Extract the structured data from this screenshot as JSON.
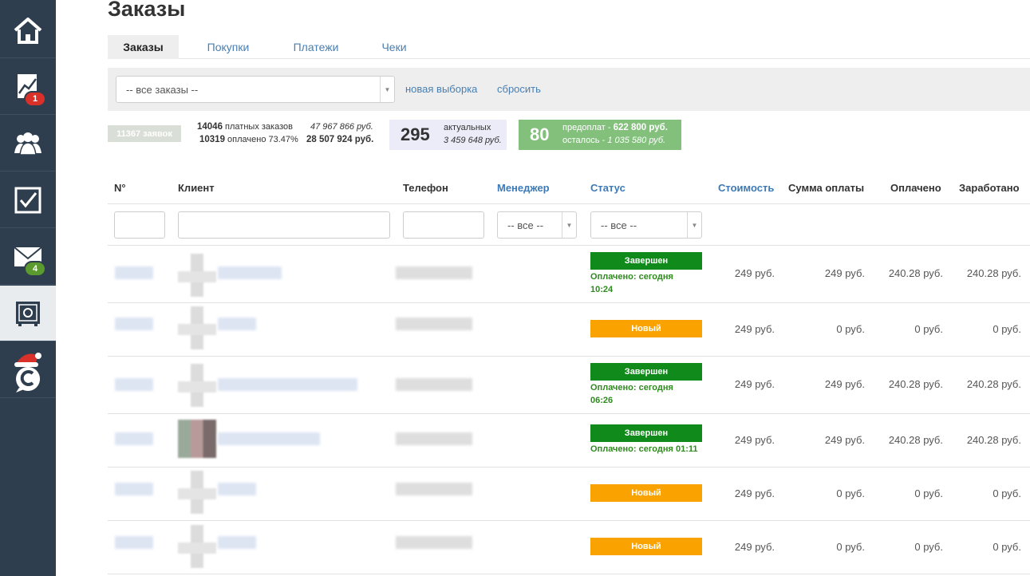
{
  "page": {
    "title": "Заказы"
  },
  "sidebar": {
    "items": [
      {
        "icon": "home-icon"
      },
      {
        "icon": "chart-icon",
        "badge": "1"
      },
      {
        "icon": "users-icon"
      },
      {
        "icon": "checkbox-icon"
      },
      {
        "icon": "mail-icon",
        "badge": "4"
      },
      {
        "icon": "safe-icon",
        "active": true
      },
      {
        "icon": "santa-logo-icon"
      }
    ]
  },
  "tabs": [
    "Заказы",
    "Покупки",
    "Платежи",
    "Чеки"
  ],
  "filter": {
    "selection": "-- все заказы --",
    "new_selection": "новая выборка",
    "reset": "сбросить"
  },
  "stats": {
    "total_requests": "11367 заявок",
    "paid_count": "14046",
    "paid_label": "платных заказов",
    "paid_sum": "47 967 866 руб.",
    "settled_count": "10319",
    "settled_label": "оплачено 73.47%",
    "settled_sum": "28 507 924 руб.",
    "actual_count": "295",
    "actual_label": "актуальных",
    "actual_sum": "3 459 648 руб.",
    "prepay_count": "80",
    "prepay_label": "предоплат - ",
    "prepay_sum": "622 800 руб.",
    "remaining_label": "осталось - ",
    "remaining_sum": "1 035 580 руб."
  },
  "table": {
    "headers": {
      "number": "N°",
      "client": "Клиент",
      "phone": "Телефон",
      "manager": "Менеджер",
      "status": "Статус",
      "cost": "Стоимость",
      "payment_sum": "Сумма оплаты",
      "paid": "Оплачено",
      "earned": "Заработано"
    },
    "manager_filter": "-- все --",
    "status_filter": "-- все --",
    "rows": [
      {
        "status": "Завершен",
        "status_type": "done",
        "paid_note": "Оплачено: сегодня 10:24",
        "cost": "249 руб.",
        "payment_sum": "249 руб.",
        "paid": "240.28 руб.",
        "earned": "240.28 руб."
      },
      {
        "status": "Новый",
        "status_type": "new",
        "paid_note": "",
        "cost": "249 руб.",
        "payment_sum": "0 руб.",
        "paid": "0 руб.",
        "earned": "0 руб."
      },
      {
        "status": "Завершен",
        "status_type": "done",
        "paid_note": "Оплачено: сегодня 06:26",
        "cost": "249 руб.",
        "payment_sum": "249 руб.",
        "paid": "240.28 руб.",
        "earned": "240.28 руб."
      },
      {
        "status": "Завершен",
        "status_type": "done",
        "paid_note": "Оплачено: сегодня 01:11",
        "cost": "249 руб.",
        "payment_sum": "249 руб.",
        "paid": "240.28 руб.",
        "earned": "240.28 руб."
      },
      {
        "status": "Новый",
        "status_type": "new",
        "paid_note": "",
        "cost": "249 руб.",
        "payment_sum": "0 руб.",
        "paid": "0 руб.",
        "earned": "0 руб."
      },
      {
        "status": "Новый",
        "status_type": "new",
        "paid_note": "",
        "cost": "249 руб.",
        "payment_sum": "0 руб.",
        "paid": "0 руб.",
        "earned": "0 руб."
      }
    ]
  }
}
